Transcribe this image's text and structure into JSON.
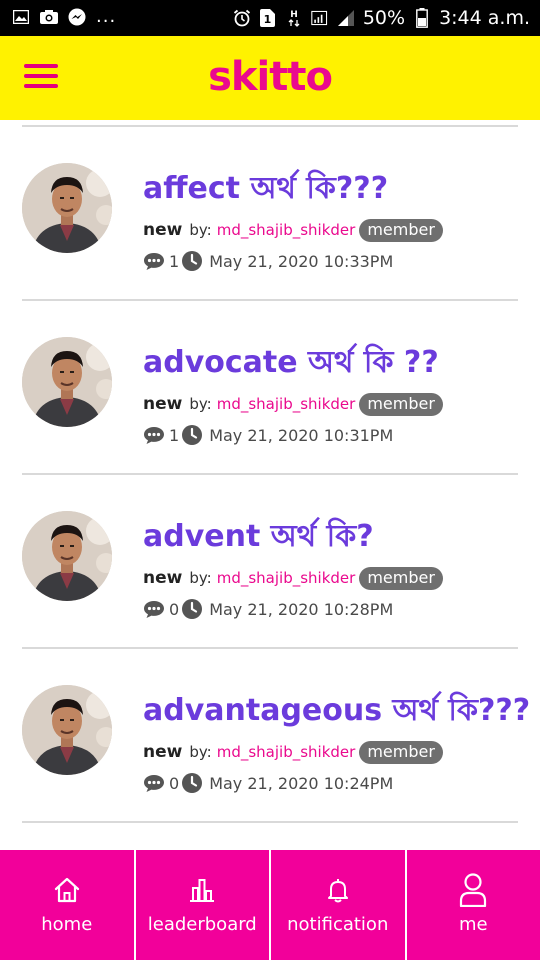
{
  "status_bar": {
    "overflow": "...",
    "battery": "50%",
    "time": "3:44 a.m.",
    "icons": [
      "gallery-icon",
      "camera-icon",
      "messenger-icon",
      "alarm-icon",
      "sim-1-icon",
      "network-h-icon",
      "signal-icon",
      "battery-icon"
    ]
  },
  "header": {
    "brand": "skitto",
    "menu_icon": "hamburger-menu-icon"
  },
  "colors": {
    "header_bg": "#fff200",
    "brand": "#ea0a8e",
    "title": "#6b3bdc",
    "username": "#ea0a8e",
    "badge_bg": "#6f6f6f",
    "nav_bg": "#f2009a"
  },
  "posts": [
    {
      "title": "affect অর্থ কি???",
      "status": "new",
      "by_label": "by:",
      "author": "md_shajib_shikder",
      "role": "member",
      "comments": "1",
      "datetime": "May 21, 2020 10:33PM"
    },
    {
      "title": "advocate অর্থ কি ??",
      "status": "new",
      "by_label": "by:",
      "author": "md_shajib_shikder",
      "role": "member",
      "comments": "1",
      "datetime": "May 21, 2020 10:31PM"
    },
    {
      "title": "advent অর্থ কি?",
      "status": "new",
      "by_label": "by:",
      "author": "md_shajib_shikder",
      "role": "member",
      "comments": "0",
      "datetime": "May 21, 2020 10:28PM"
    },
    {
      "title": "advantageous অর্থ কি???",
      "status": "new",
      "by_label": "by:",
      "author": "md_shajib_shikder",
      "role": "member",
      "comments": "0",
      "datetime": "May 21, 2020 10:24PM"
    }
  ],
  "bottom_nav": [
    {
      "label": "home",
      "icon": "home-icon"
    },
    {
      "label": "leaderboard",
      "icon": "leaderboard-icon"
    },
    {
      "label": "notification",
      "icon": "bell-icon"
    },
    {
      "label": "me",
      "icon": "user-icon"
    }
  ]
}
